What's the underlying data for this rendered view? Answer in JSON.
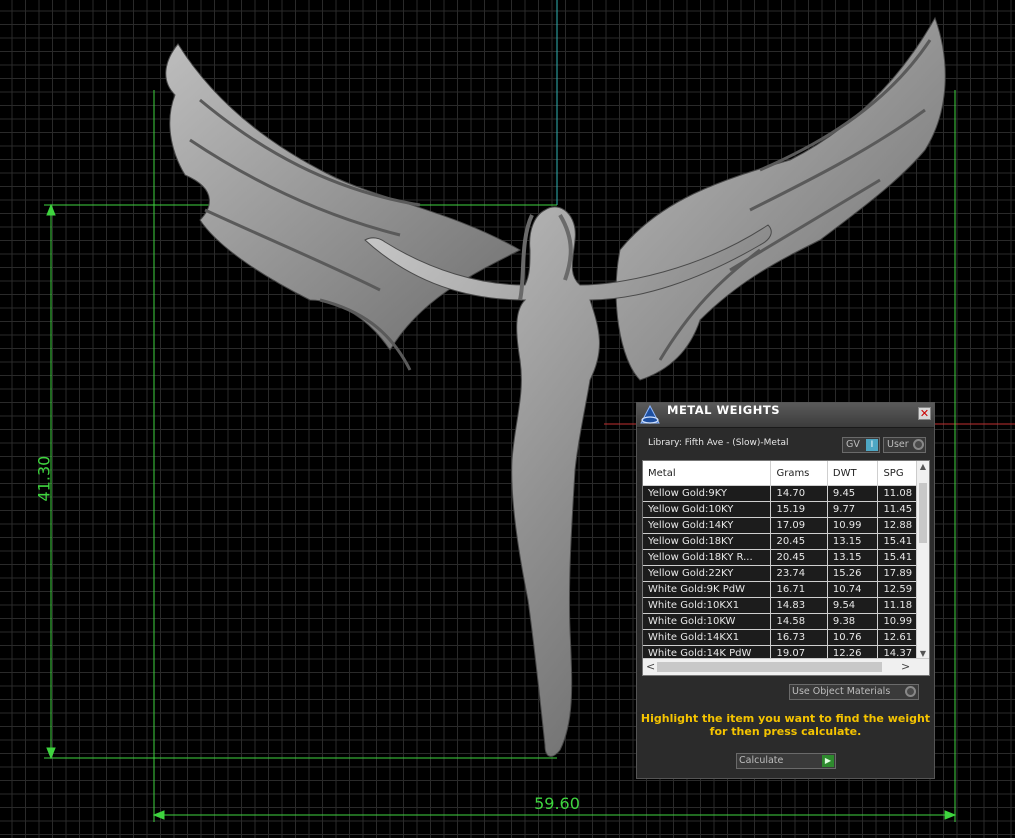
{
  "dimensions": {
    "height_label": "41.30",
    "width_label": "59.60"
  },
  "colors": {
    "dimension_lines": "#3fd43f",
    "axis_vertical": "#2fb3b3",
    "axis_horizontal": "#c03030",
    "hint_text": "#f5c400"
  },
  "panel": {
    "title": "METAL WEIGHTS",
    "close_icon": "close-icon",
    "library": "Library: Fifth Ave - (Slow)-Metal",
    "toggle_gv": "GV",
    "toggle_gv_state": "I",
    "toggle_user": "User",
    "table": {
      "headers": [
        "Metal",
        "Grams",
        "DWT",
        "SPG"
      ],
      "rows": [
        [
          "Yellow Gold:9KY",
          "14.70",
          "9.45",
          "11.08"
        ],
        [
          "Yellow Gold:10KY",
          "15.19",
          "9.77",
          "11.45"
        ],
        [
          "Yellow Gold:14KY",
          "17.09",
          "10.99",
          "12.88"
        ],
        [
          "Yellow Gold:18KY",
          "20.45",
          "13.15",
          "15.41"
        ],
        [
          "Yellow Gold:18KY R...",
          "20.45",
          "13.15",
          "15.41"
        ],
        [
          "Yellow Gold:22KY",
          "23.74",
          "15.26",
          "17.89"
        ],
        [
          "White Gold:9K PdW",
          "16.71",
          "10.74",
          "12.59"
        ],
        [
          "White Gold:10KX1",
          "14.83",
          "9.54",
          "11.18"
        ],
        [
          "White Gold:10KW",
          "14.58",
          "9.38",
          "10.99"
        ],
        [
          "White Gold:14KX1",
          "16.73",
          "10.76",
          "12.61"
        ],
        [
          "White Gold:14K PdW",
          "19.07",
          "12.26",
          "14.37"
        ]
      ]
    },
    "use_object_materials": "Use Object Materials",
    "hint_line1": "Highlight the item you want to find the weight",
    "hint_line2": "for then press calculate.",
    "calculate": "Calculate"
  }
}
